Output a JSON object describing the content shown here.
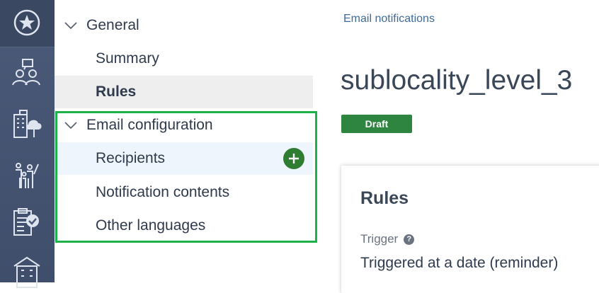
{
  "nav": {
    "general": {
      "label": "General",
      "items": [
        {
          "label": "Summary"
        },
        {
          "label": "Rules"
        }
      ]
    },
    "email_configuration": {
      "label": "Email configuration",
      "items": [
        {
          "label": "Recipients"
        },
        {
          "label": "Notification contents"
        },
        {
          "label": "Other languages"
        }
      ]
    }
  },
  "breadcrumb": "Email notifications",
  "page_title": "sublocality_level_3",
  "status": "Draft",
  "card": {
    "title": "Rules",
    "trigger_label": "Trigger",
    "trigger_value": "Triggered at a date (reminder)"
  },
  "colors": {
    "rail": "#4a5a78",
    "accent_green": "#2e7d32",
    "highlight": "#1db14b",
    "link": "#3d6b9b"
  },
  "icons": [
    "star-icon",
    "meeting-icon",
    "buildings-icon",
    "family-icon",
    "clipboard-check-icon",
    "apartment-icon",
    "chevron-down-icon",
    "plus-icon",
    "help-icon"
  ]
}
